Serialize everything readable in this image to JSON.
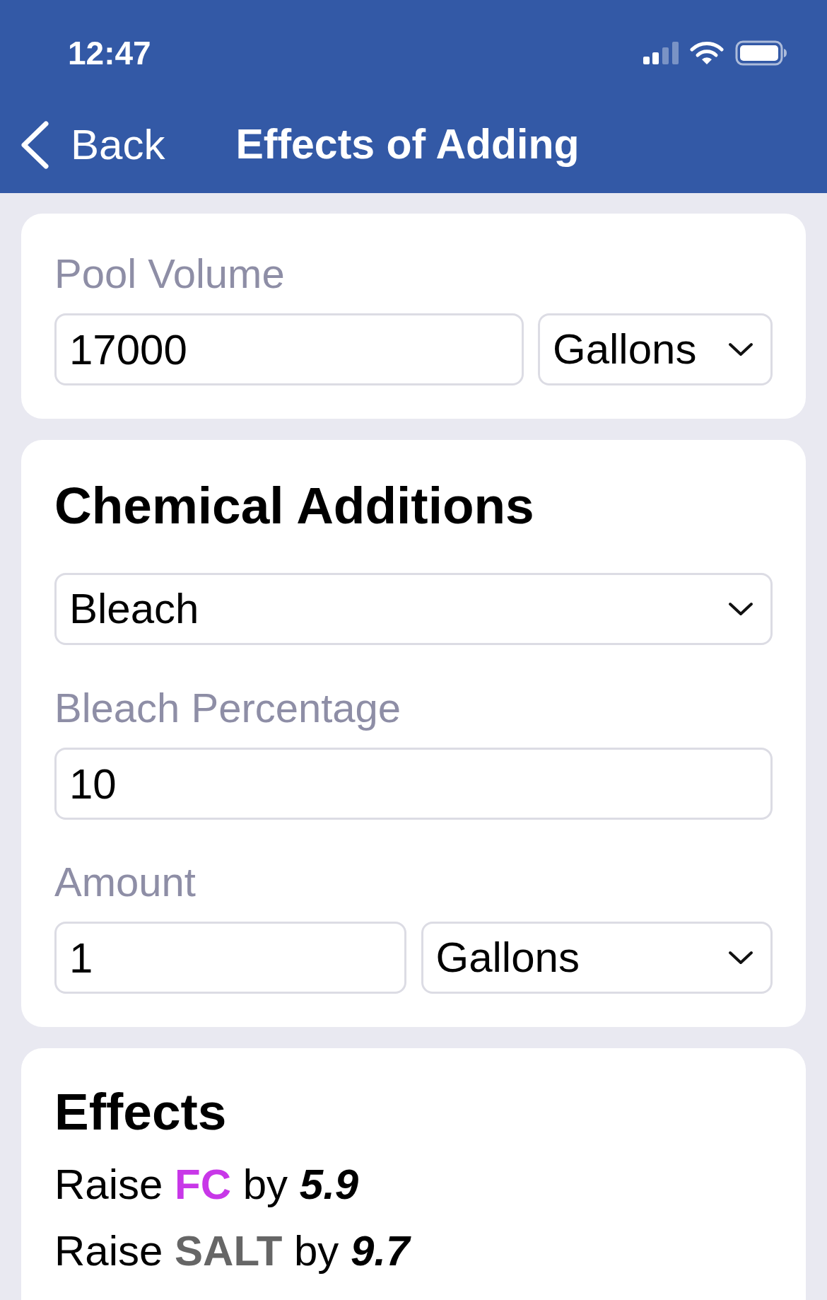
{
  "status_bar": {
    "time": "12:47"
  },
  "nav_bar": {
    "back": "Back",
    "title": "Effects of Adding"
  },
  "pool_volume": {
    "label": "Pool Volume",
    "value": "17000",
    "unit": "Gallons"
  },
  "chemical_additions": {
    "title": "Chemical Additions",
    "chemical": "Bleach",
    "percentage": {
      "label": "Bleach Percentage",
      "value": "10"
    },
    "amount": {
      "label": "Amount",
      "value": "1",
      "unit": "Gallons"
    }
  },
  "effects": {
    "title": "Effects",
    "items": [
      {
        "verb": "Raise",
        "parameter": "FC",
        "color": "#c837e8",
        "connector": "by",
        "amount": "5.9"
      },
      {
        "verb": "Raise",
        "parameter": "SALT",
        "color": "#666666",
        "connector": "by",
        "amount": "9.7"
      }
    ]
  }
}
